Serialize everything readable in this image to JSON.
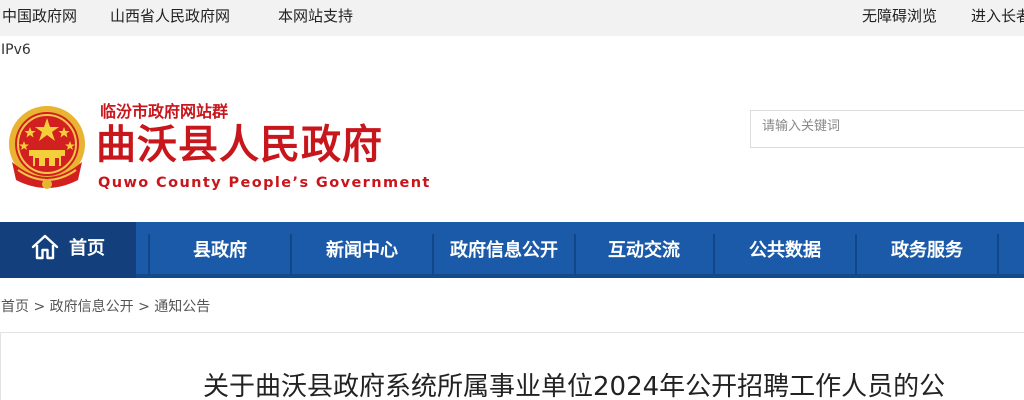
{
  "topbar": {
    "links_left": [
      "中国政府网",
      "山西省人民政府网",
      "本网站支持"
    ],
    "links_right": [
      "无障碍浏览",
      "进入长者"
    ]
  },
  "ipv6": "IPv6",
  "header": {
    "site_group": "临汾市政府网站群",
    "title": "曲沃县人民政府",
    "title_en": "Quwo County People’s Government",
    "emblem_icon": "national-emblem-icon",
    "brand_color": "#c8161d"
  },
  "search": {
    "placeholder": "请输入关键词"
  },
  "nav": {
    "home": "首页",
    "items": [
      "县政府",
      "新闻中心",
      "政府信息公开",
      "互动交流",
      "公共数据",
      "政务服务"
    ],
    "color": "#1a5aa8",
    "home_color": "#13407d"
  },
  "breadcrumb": {
    "items": [
      "首页",
      "政府信息公开",
      "通知公告"
    ],
    "separator": ">"
  },
  "article": {
    "title": "关于曲沃县政府系统所属事业单位2024年公开招聘工作人员的公"
  }
}
